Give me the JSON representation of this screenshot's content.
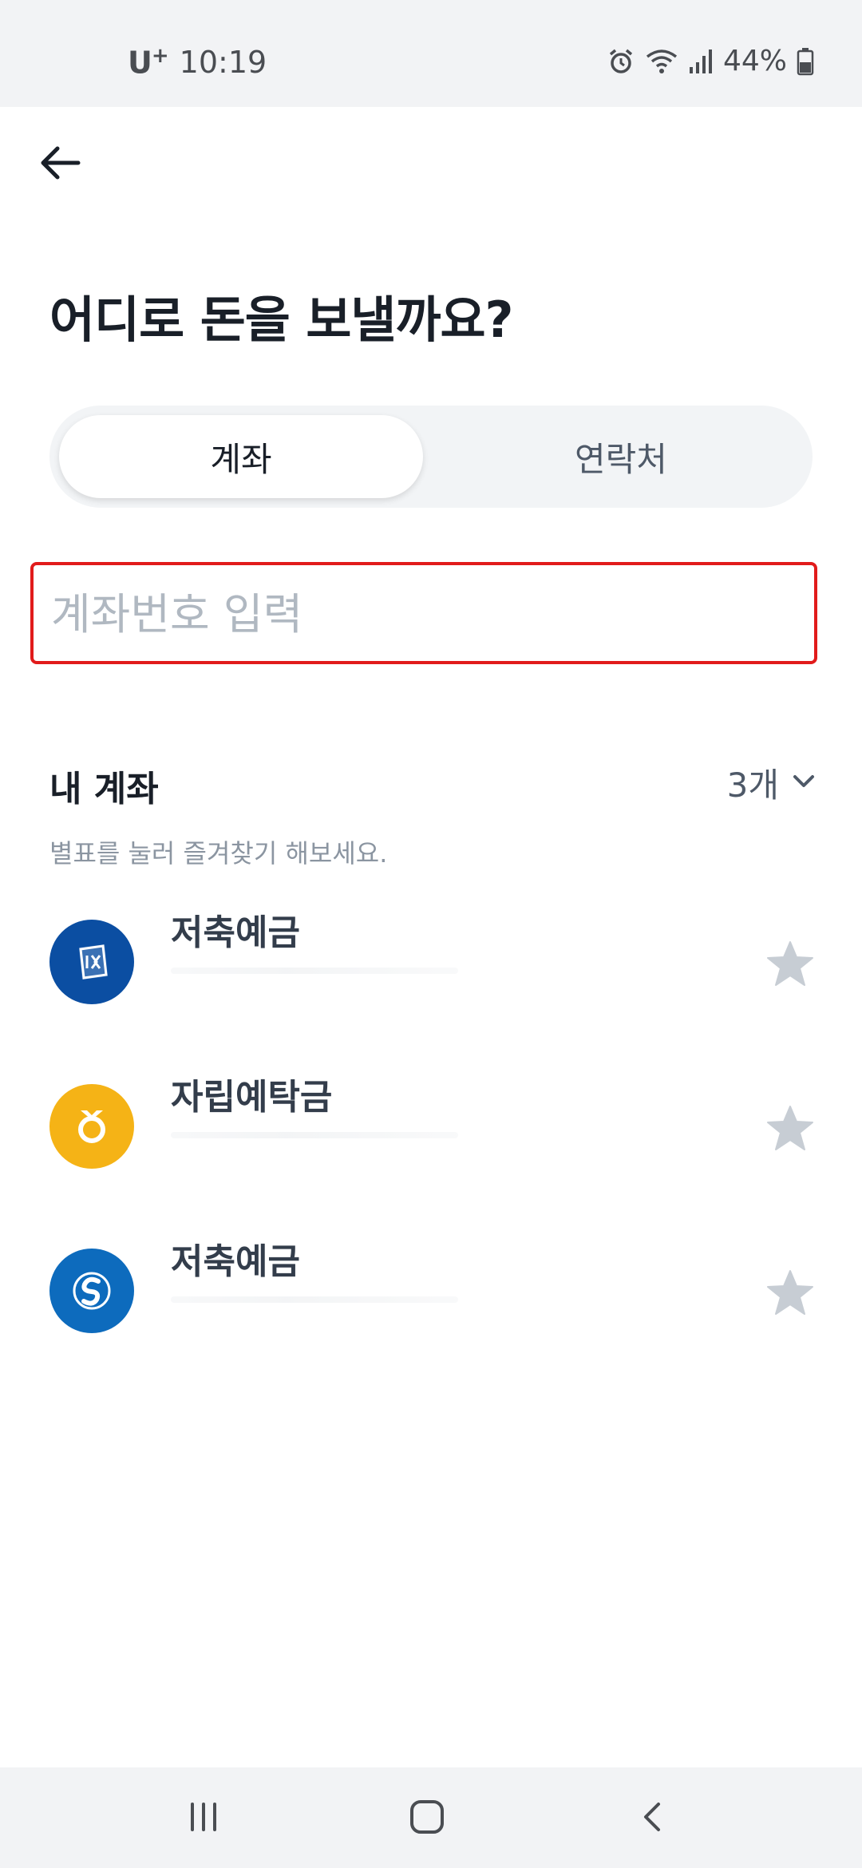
{
  "status_bar": {
    "carrier": "U",
    "carrier_sup": "+",
    "time": "10:19",
    "battery": "44%",
    "icons": [
      "alarm-icon",
      "wifi-icon",
      "signal-icon",
      "battery-icon"
    ]
  },
  "header": {
    "back_icon": "arrow-left-icon"
  },
  "page": {
    "title": "어디로 돈을 보낼까요?"
  },
  "tabs": [
    {
      "label": "계좌",
      "selected": true
    },
    {
      "label": "연락처",
      "selected": false
    }
  ],
  "account_input": {
    "placeholder": "계좌번호 입력",
    "value": ""
  },
  "my_accounts": {
    "title": "내 계좌",
    "count": "3개",
    "hint": "별표를 눌러 즐겨찾기 해보세요.",
    "items": [
      {
        "name": "저축예금",
        "logo": "ibk-bank-logo",
        "logo_color": "#0b4ea2",
        "favorite": false
      },
      {
        "name": "자립예탁금",
        "logo": "saemaeul-logo",
        "logo_color": "#f5b316",
        "favorite": false
      },
      {
        "name": "저축예금",
        "logo": "shinhan-bank-logo",
        "logo_color": "#0d6bbd",
        "favorite": false
      }
    ]
  },
  "colors": {
    "accent_border": "#e11b1b",
    "title": "#191f28",
    "star": "#c7cdd4"
  },
  "nav_bar": {
    "icons": [
      "recent-apps-icon",
      "home-icon",
      "back-icon"
    ]
  }
}
